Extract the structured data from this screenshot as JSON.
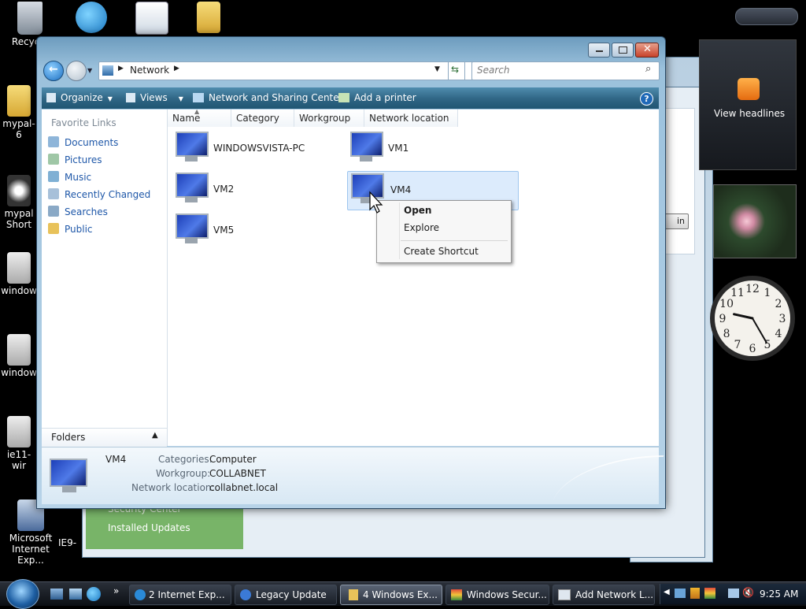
{
  "desktop": {
    "icons": [
      {
        "label": "Recycle",
        "icon": "recycle-bin-icon"
      },
      {
        "label": "mypal-6",
        "icon": "folder-icon"
      },
      {
        "label": "mypal Short",
        "icon": "shortcut-icon"
      },
      {
        "label": "window",
        "icon": "disc-icon"
      },
      {
        "label": "window",
        "icon": "disc-icon"
      },
      {
        "label": "ie11-wir",
        "icon": "disc-icon"
      },
      {
        "label": "Microsoft Internet Exp...",
        "icon": "ie-shield-icon"
      },
      {
        "label": "IE9-",
        "icon": "app-icon"
      }
    ],
    "bg_window_items": {
      "security_center": "Security Center",
      "installed_updates": "Installed Updates"
    }
  },
  "gadgets": {
    "rss_label": "View headlines",
    "clock": {
      "hour": 9,
      "minute": 25
    }
  },
  "explorer": {
    "breadcrumb": "Network",
    "search_placeholder": "Search",
    "toolbar": {
      "organize": "Organize",
      "views": "Views",
      "network_sharing": "Network and Sharing Center",
      "add_printer": "Add a printer"
    },
    "nav": {
      "header": "Favorite Links",
      "links": [
        "Documents",
        "Pictures",
        "Music",
        "Recently Changed",
        "Searches",
        "Public"
      ],
      "folders": "Folders"
    },
    "columns": [
      "Name",
      "Category",
      "Workgroup",
      "Network location"
    ],
    "computers": [
      "WINDOWSVISTA-PC",
      "VM1",
      "VM2",
      "VM4",
      "VM5"
    ],
    "context_menu": [
      "Open",
      "Explore",
      "Create Shortcut"
    ],
    "details": {
      "name": "VM4",
      "categories_label": "Categories:",
      "categories_value": "Computer",
      "workgroup_label": "Workgroup:",
      "workgroup_value": "COLLABNET",
      "location_label": "Network location:",
      "location_value": "collabnet.local"
    }
  },
  "taskbar": {
    "tasks": [
      "2 Internet Exp...",
      "Legacy Update",
      "4 Windows Ex...",
      "Windows Secur...",
      "Add Network L..."
    ],
    "time": "9:25 AM"
  },
  "colors": {
    "accent": "#2f6584",
    "link": "#1e57a8",
    "selection": "#dcebfc"
  }
}
